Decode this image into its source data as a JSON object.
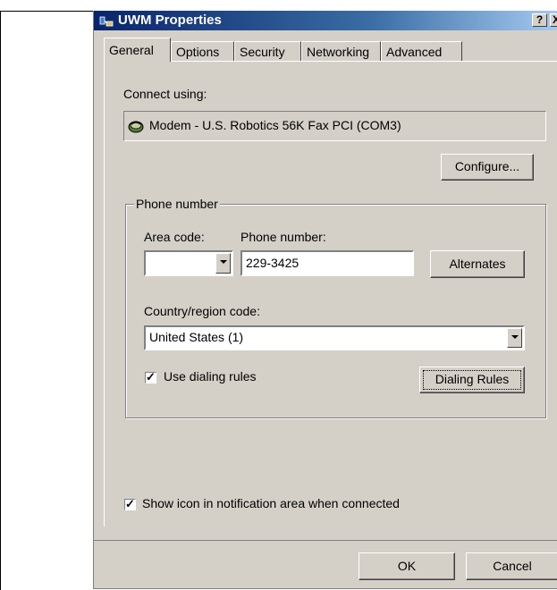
{
  "window": {
    "title": "UWM Properties",
    "help_label": "?",
    "close_label": "X"
  },
  "tabs": [
    {
      "label": "General",
      "active": true
    },
    {
      "label": "Options",
      "active": false
    },
    {
      "label": "Security",
      "active": false
    },
    {
      "label": "Networking",
      "active": false
    },
    {
      "label": "Advanced",
      "active": false
    }
  ],
  "general": {
    "connect_using_label": "Connect using:",
    "device_name": "Modem - U.S. Robotics 56K Fax PCI (COM3)",
    "device_icon": "modem-icon",
    "configure_label": "Configure...",
    "phone_group_label": "Phone number",
    "area_code_label": "Area code:",
    "area_code_value": "",
    "phone_number_label": "Phone number:",
    "phone_number_value": "229-3425",
    "alternates_label": "Alternates",
    "country_label": "Country/region code:",
    "country_value": "United States (1)",
    "use_dialing_rules_label": "Use dialing rules",
    "use_dialing_rules_checked": true,
    "dialing_rules_label": "Dialing Rules",
    "show_icon_label": "Show icon in notification area when connected",
    "show_icon_checked": true
  },
  "footer": {
    "ok_label": "OK",
    "cancel_label": "Cancel"
  },
  "colors": {
    "dialog_face": "#d4d0c8",
    "titlebar_start": "#0a246a",
    "titlebar_end": "#a6caf0"
  }
}
